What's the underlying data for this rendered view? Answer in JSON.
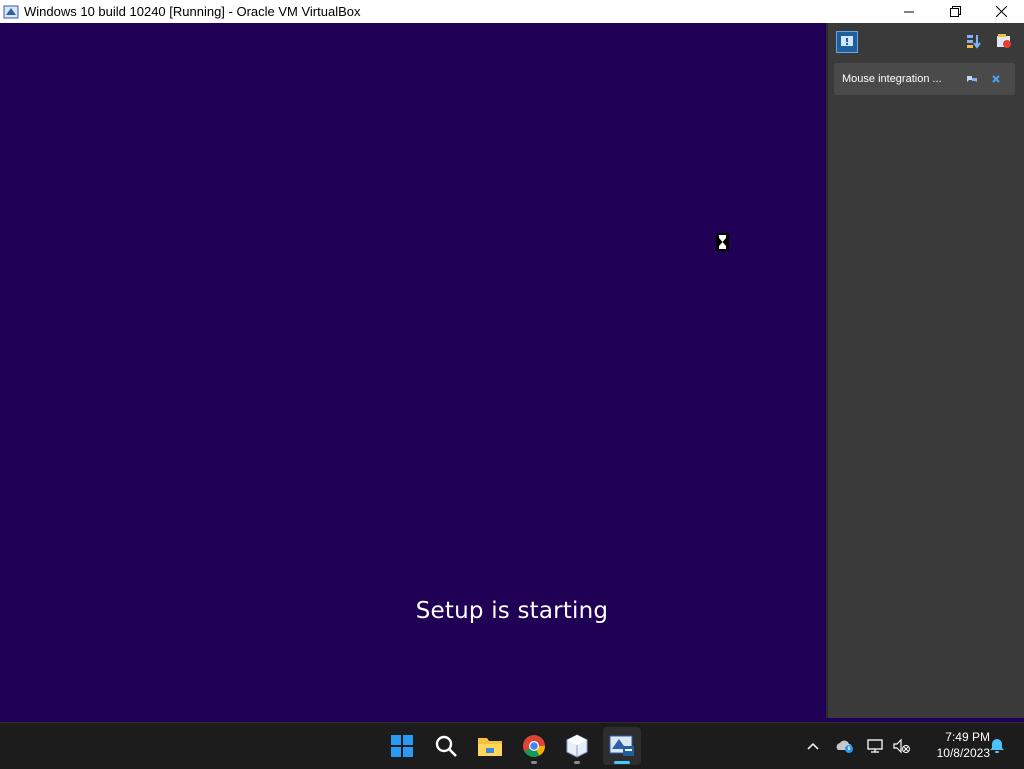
{
  "window": {
    "title": "Windows 10 build 10240 [Running] - Oracle VM VirtualBox",
    "controls": {
      "minimize": "—",
      "restore": "❐",
      "close": "✕"
    }
  },
  "vm": {
    "status_text": "Setup is starting",
    "background_color": "#1f0055"
  },
  "side_panel": {
    "toolbar": [
      "notifications-icon",
      "sort-icon",
      "tools-icon"
    ],
    "notification": {
      "message": "Mouse integration ...",
      "actions": [
        "help-icon",
        "close-icon"
      ]
    }
  },
  "taskbar": {
    "apps": [
      "start-icon",
      "search-icon",
      "file-explorer-icon",
      "chrome-icon",
      "virtualbox-icon",
      "vm-window-icon"
    ],
    "clock": {
      "time": "7:49 PM",
      "date": "10/8/2023"
    },
    "tray": [
      "chevron-up-icon",
      "onedrive-icon",
      "network-icon",
      "volume-muted-icon",
      "notification-bell-icon"
    ]
  },
  "colors": {
    "accent": "#4cc2ff",
    "panel": "#3a3a3a",
    "taskbar": "#1c1c1c"
  }
}
